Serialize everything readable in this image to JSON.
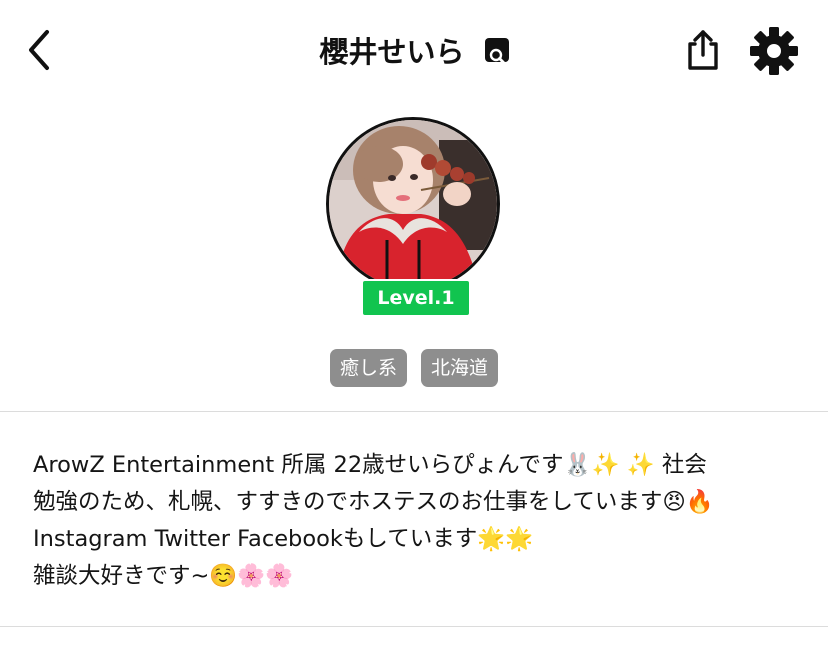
{
  "header": {
    "title": "櫻井せいら",
    "back_icon": "chevron-left-icon",
    "verified_icon": "search-badge-icon",
    "share_icon": "share-icon",
    "settings_icon": "gear-icon"
  },
  "profile": {
    "avatar": "profile-photo",
    "level": "Level.1",
    "tags": [
      "癒し系",
      "北海道"
    ]
  },
  "bio": {
    "lines": [
      "ArowZ Entertainment 所属 22歳せいらぴょんです🐰✨ ✨ 社会",
      "勉強のため、札幌、すすきのでホステスのお仕事をしています😠🔥",
      "Instagram Twitter Facebookもしています🌟🌟",
      "雑談大好きです~☺️🌸🌸"
    ]
  },
  "colors": {
    "level_badge": "#11c44f",
    "tag_bg": "#8e8e8e",
    "divider": "#dcdcdc"
  }
}
